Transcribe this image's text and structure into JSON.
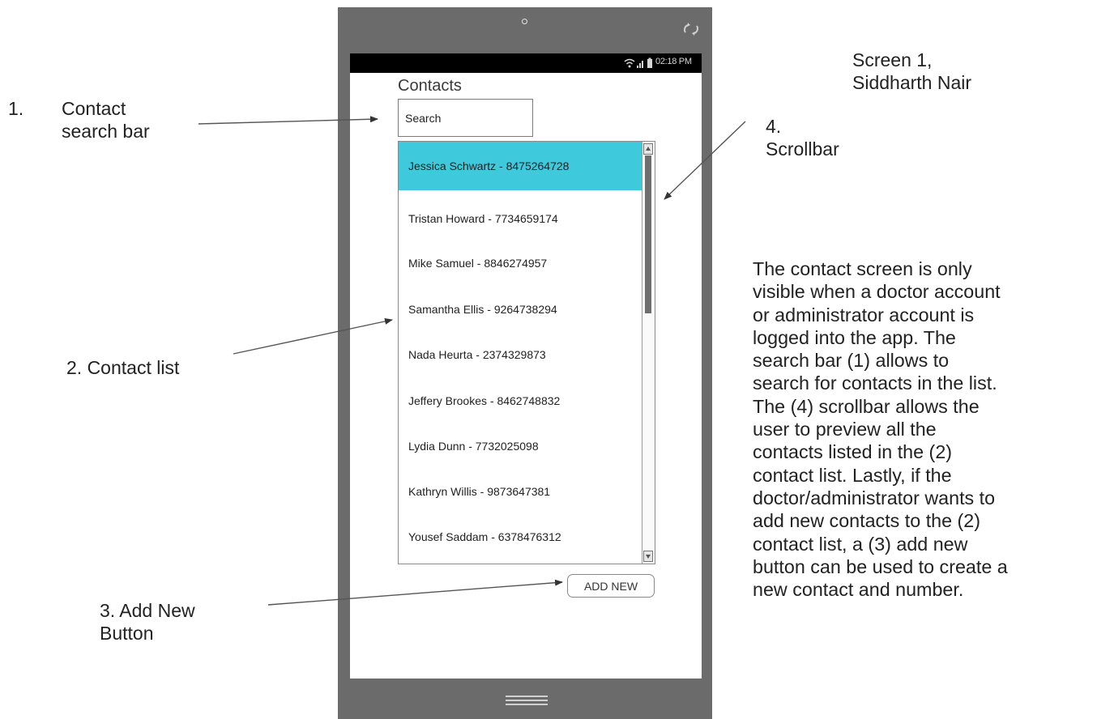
{
  "credit": {
    "screen_label": "Screen 1,",
    "author": "Siddharth Nair"
  },
  "phone": {
    "status_time": "02:18 PM",
    "app_title": "Contacts",
    "search_placeholder": "Search",
    "contacts": [
      {
        "label": "Jessica Schwartz - 8475264728",
        "selected": true
      },
      {
        "label": "Tristan Howard - 7734659174",
        "selected": false
      },
      {
        "label": "Mike Samuel - 8846274957",
        "selected": false
      },
      {
        "label": "Samantha Ellis - 9264738294",
        "selected": false
      },
      {
        "label": "Nada Heurta - 2374329873",
        "selected": false
      },
      {
        "label": "Jeffery Brookes - 8462748832",
        "selected": false
      },
      {
        "label": "Lydia Dunn - 7732025098",
        "selected": false
      },
      {
        "label": "Kathryn Willis - 9873647381",
        "selected": false
      },
      {
        "label": "Yousef Saddam - 6378476312",
        "selected": false
      }
    ],
    "add_button": "ADD NEW",
    "highlight_color": "#3ec9dd"
  },
  "annotations": {
    "a1_number": "1.",
    "a1_line1": "Contact",
    "a1_line2": "search bar",
    "a2": "2. Contact list",
    "a3_line1": "3. Add New",
    "a3_line2": "Button",
    "a4_line1": "4.",
    "a4_line2": "Scrollbar"
  },
  "description_lines": [
    "The contact screen is only",
    "visible when a doctor account",
    "or administrator account is",
    "logged into the app. The",
    "search bar (1) allows to",
    "search for contacts in the list.",
    "The (4) scrollbar allows the",
    "user to preview all the",
    "contacts listed in the (2)",
    "contact list. Lastly, if the",
    "doctor/administrator wants to",
    "add new contacts to the (2)",
    "contact list, a (3) add new",
    "button can be used to create a",
    "new contact and number."
  ]
}
